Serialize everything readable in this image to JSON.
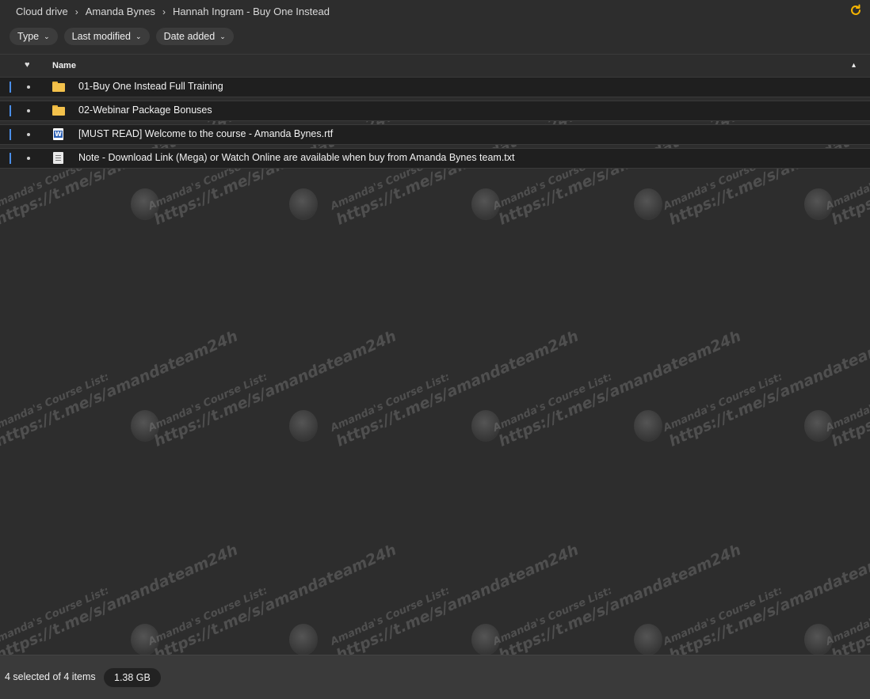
{
  "breadcrumb": [
    {
      "label": "Cloud drive"
    },
    {
      "label": "Amanda Bynes"
    },
    {
      "label": "Hannah Ingram - Buy One Instead"
    }
  ],
  "breadcrumb_separator": "›",
  "filters": [
    {
      "label": "Type"
    },
    {
      "label": "Last modified"
    },
    {
      "label": "Date added"
    }
  ],
  "table_header": {
    "favorite_glyph": "♥",
    "name_label": "Name",
    "sort_glyph": "▴"
  },
  "files": [
    {
      "name": "01-Buy One Instead Full Training",
      "type": "folder",
      "icon": "folder-icon",
      "selected": true
    },
    {
      "name": "02-Webinar Package Bonuses",
      "type": "folder",
      "icon": "folder-icon",
      "selected": true
    },
    {
      "name": "[MUST READ] Welcome to the course - Amanda Bynes.rtf",
      "type": "word",
      "icon": "word-document-icon",
      "selected": true
    },
    {
      "name": "Note - Download Link (Mega) or Watch Online are available when buy from Amanda Bynes team.txt",
      "type": "text",
      "icon": "text-file-icon",
      "selected": true
    }
  ],
  "watermark": {
    "line1": "Amanda's Course List:",
    "line2": "https://t.me/s/amandateam24h"
  },
  "status": {
    "selection_text": "4 selected of 4 items",
    "total_size": "1.38 GB"
  },
  "colors": {
    "accent": "#4a8ee8",
    "refresh": "#f5b400",
    "folder": "#f3c14b",
    "background": "#2d2d2d"
  }
}
